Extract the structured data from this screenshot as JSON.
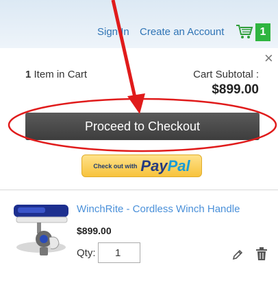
{
  "header": {
    "sign_in": "Sign In",
    "create_account": "Create an Account",
    "cart_count": "1"
  },
  "minicart": {
    "close": "×",
    "item_count": "1",
    "item_count_label": " Item in Cart",
    "subtotal_label": "Cart Subtotal :",
    "subtotal_value": "$899.00",
    "checkout_label": "Proceed to Checkout",
    "paypal_prefix": "Check out with",
    "paypal_pay": "Pay",
    "paypal_pal": "Pal"
  },
  "item": {
    "name": "WinchRite - Cordless Winch Handle",
    "price": "$899.00",
    "qty_label": "Qty:",
    "qty_value": "1"
  },
  "colors": {
    "accent_link": "#2f74b5",
    "badge_green": "#2fb540",
    "annotation_red": "#e01b1b"
  },
  "icons": [
    "cart-icon",
    "close-icon",
    "edit-icon",
    "trash-icon"
  ]
}
